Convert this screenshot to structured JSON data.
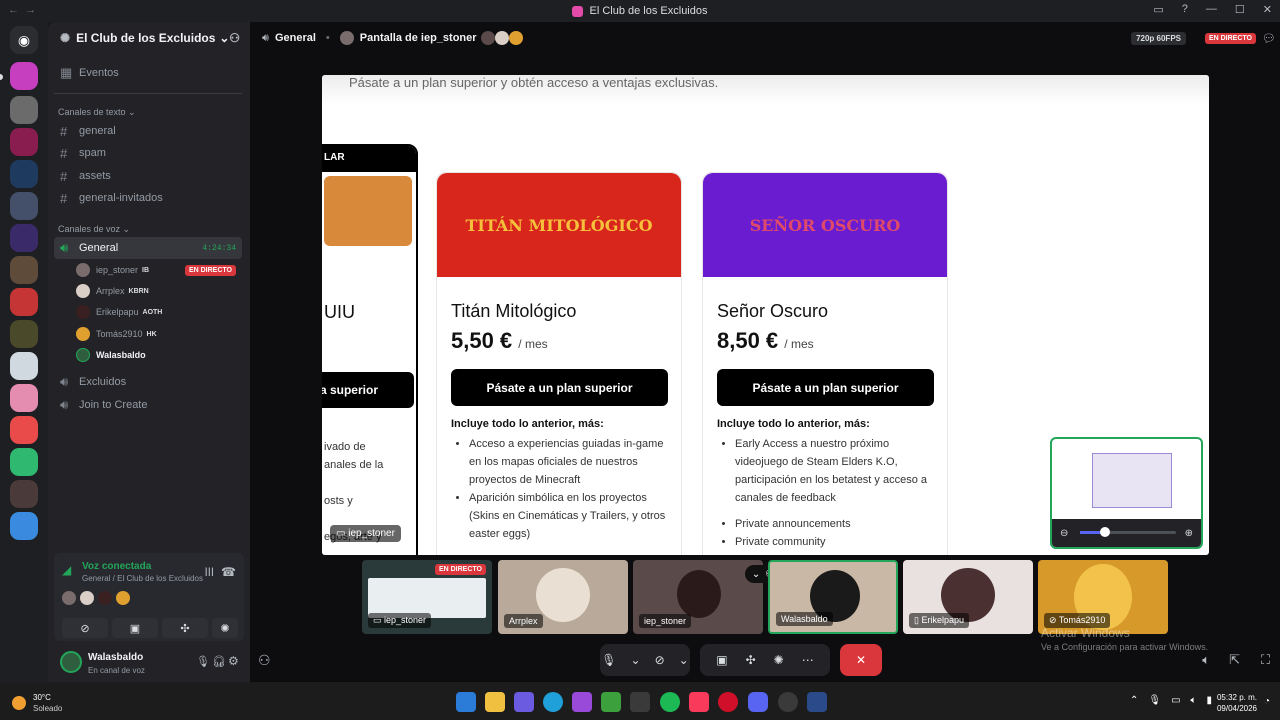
{
  "window": {
    "title": "El Club de los Excluidos"
  },
  "server": {
    "name": "El Club de los Excluidos",
    "events_label": "Eventos",
    "text_category": "Canales de texto",
    "text_channels": [
      "general",
      "spam",
      "assets",
      "general-invitados"
    ],
    "voice_category": "Canales de voz",
    "voice_channels": [
      {
        "name": "General",
        "time": "4:24:34"
      },
      {
        "name": "Excluidos"
      },
      {
        "name": "Join to Create"
      }
    ],
    "voice_users": [
      {
        "name": "iep_stoner",
        "tag": "IB",
        "badge": "EN DIRECTO",
        "color": "#7a6c6c"
      },
      {
        "name": "Arrplex",
        "tag": "KBRN",
        "color": "#d9cfc6"
      },
      {
        "name": "Erikelpapu",
        "tag": "AOTH",
        "color": "#3a2020"
      },
      {
        "name": "Tomás2910",
        "tag": "HK",
        "color": "#e0a030"
      },
      {
        "name": "Walasbaldo",
        "color": "#2e5e3e"
      }
    ]
  },
  "voice_panel": {
    "status": "Voz conectada",
    "location": "General / El Club de los Excluidos"
  },
  "user": {
    "name": "Walasbaldo",
    "status": "En canal de voz"
  },
  "topbar": {
    "channel": "General",
    "stream_title": "Pantalla de iep_stoner",
    "quality": "720p 60FPS",
    "live": "EN DIRECTO"
  },
  "stream": {
    "banner": "Pásate a un plan superior y obtén acceso a ventajas exclusivas.",
    "partial_left": {
      "top": "LAR",
      "title": "UIU",
      "button": "a superior",
      "text": [
        "ivado de",
        "anales de la",
        "osts y",
        "egos, arte y"
      ]
    },
    "cards": [
      {
        "ticket_text": "TITÁN MITOLÓGICO",
        "ticket_color": "#d8261c",
        "name": "Titán Mitológico",
        "price": "5,50 €",
        "per": "/ mes",
        "button": "Pásate a un plan superior",
        "includes": "Incluye todo lo anterior, más:",
        "items": [
          "Acceso a experiencias guiadas in-game en los mapas oficiales de nuestros proyectos de Minecraft",
          "Aparición simbólica en los proyectos (Skins en Cinemáticas y Trailers, y otros easter eggs)"
        ]
      },
      {
        "ticket_text": "SEÑOR OSCURO",
        "ticket_color": "#6a1cd0",
        "name": "Señor Oscuro",
        "price": "8,50 €",
        "per": "/ mes",
        "button": "Pásate a un plan superior",
        "includes": "Incluye todo lo anterior, más:",
        "items": [
          "Early Access a nuestro próximo videojuego de Steam Elders K.O, participación en los betatest y acceso a canales de feedback",
          "Private announcements",
          "Private community"
        ]
      }
    ],
    "streamer_label": "iep_stoner"
  },
  "tiles": [
    {
      "name": "iep_stoner",
      "live": "EN DIRECTO",
      "color": "#2a3a3a"
    },
    {
      "name": "Arrplex",
      "color": "#b9a99a"
    },
    {
      "name": "iep_stoner",
      "color": "#5a4a4a"
    },
    {
      "name": "Walasbaldo",
      "color": "#c9b8a6"
    },
    {
      "name": "Erikelpapu",
      "color": "#e9e0e0"
    },
    {
      "name": "Tomás2910",
      "color": "#d79a2a"
    }
  ],
  "watermark": {
    "line1": "Activar Windows",
    "line2": "Ve a Configuración para activar Windows."
  },
  "taskbar": {
    "weather_temp": "30°C",
    "weather_desc": "Soleado",
    "time": "05:32 p. m.",
    "date": "09/04/2026"
  }
}
